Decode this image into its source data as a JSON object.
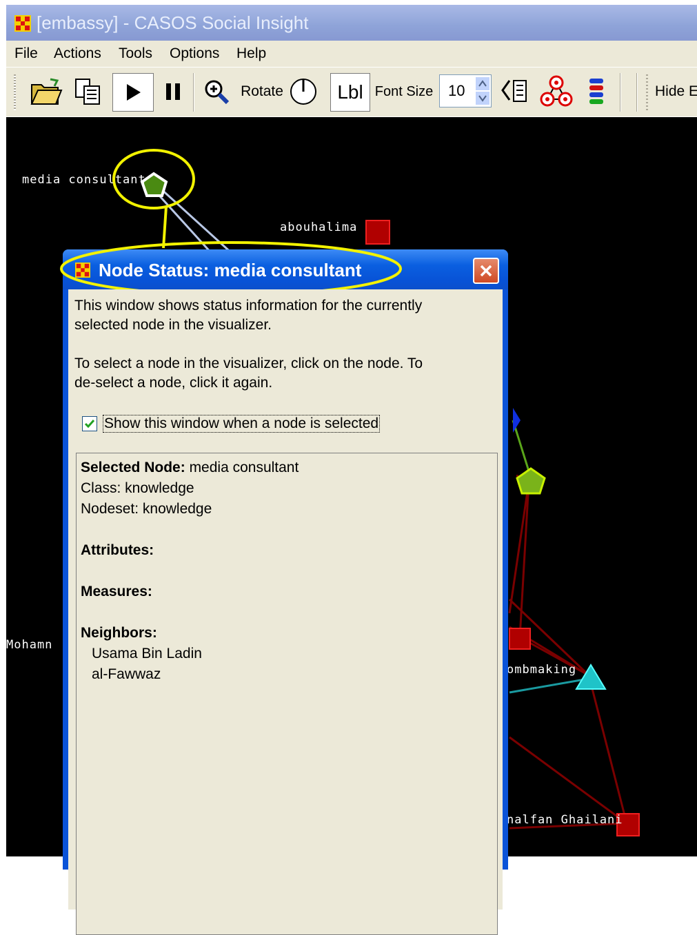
{
  "window": {
    "title": "[embassy] - CASOS Social Insight"
  },
  "menu": {
    "items": [
      "File",
      "Actions",
      "Tools",
      "Options",
      "Help"
    ]
  },
  "toolbar": {
    "rotate_label": "Rotate",
    "lbl_label": "Lbl",
    "font_size_label": "Font Size",
    "font_size_value": "10",
    "hide_label": "Hide E"
  },
  "graph": {
    "labels": {
      "media_consultant": "media consultant",
      "abouhalima": "abouhalima",
      "mohamn": "Mohamn",
      "bombmaking": "ombmaking",
      "ghailani": "nalfan Ghailani"
    },
    "colors": {
      "highlight": "#f2f200",
      "red_node": "#b00000",
      "green_node": "#4a8a12",
      "cyan_node": "#1fc3c8",
      "blue_node": "#1030e0",
      "edge_red": "#7a0000"
    }
  },
  "dialog": {
    "title": "Node Status: media consultant",
    "desc1_line1": "This window shows status information for the currently",
    "desc1_line2": "selected node in the visualizer.",
    "desc2_line1": "To select a node in the visualizer, click on the node. To",
    "desc2_line2": "de-select a node, click it again.",
    "checkbox_label": "Show this window when a node is selected",
    "checkbox_checked": true,
    "selected_node_label": "Selected Node:",
    "selected_node_value": "media consultant",
    "class_line": "Class: knowledge",
    "nodeset_line": "Nodeset: knowledge",
    "attributes_label": "Attributes:",
    "measures_label": "Measures:",
    "neighbors_label": "Neighbors:",
    "neighbors": [
      "Usama Bin Ladin",
      "al-Fawwaz"
    ]
  }
}
